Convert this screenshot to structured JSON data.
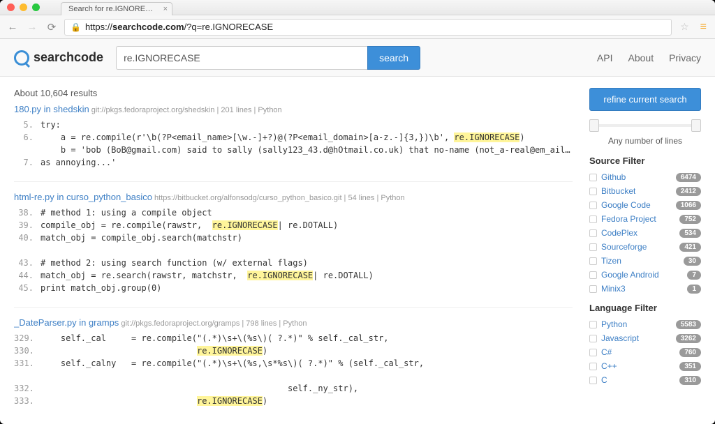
{
  "browser": {
    "tab_title": "Search for re.IGNORECASE",
    "url": "https://searchcode.com/?q=re.IGNORECASE",
    "host": "searchcode.com",
    "proto": "https://",
    "path": "/?q=re.IGNORECASE"
  },
  "brand": "searchcode",
  "search": {
    "value": "re.IGNORECASE",
    "button": "search"
  },
  "topnav": {
    "api": "API",
    "about": "About",
    "privacy": "Privacy"
  },
  "results_count": "About 10,604 results",
  "sidebar": {
    "refine": "refine current search",
    "slider_label": "Any number of lines",
    "source_head": "Source Filter",
    "sources": [
      {
        "label": "Github",
        "count": "6474"
      },
      {
        "label": "Bitbucket",
        "count": "2412"
      },
      {
        "label": "Google Code",
        "count": "1066"
      },
      {
        "label": "Fedora Project",
        "count": "752"
      },
      {
        "label": "CodePlex",
        "count": "534"
      },
      {
        "label": "Sourceforge",
        "count": "421"
      },
      {
        "label": "Tizen",
        "count": "30"
      },
      {
        "label": "Google Android",
        "count": "7"
      },
      {
        "label": "Minix3",
        "count": "1"
      }
    ],
    "lang_head": "Language Filter",
    "langs": [
      {
        "label": "Python",
        "count": "5583"
      },
      {
        "label": "Javascript",
        "count": "3262"
      },
      {
        "label": "C#",
        "count": "760"
      },
      {
        "label": "C++",
        "count": "351"
      },
      {
        "label": "C",
        "count": "310"
      }
    ]
  },
  "results": [
    {
      "title": "180.py in shedskin",
      "meta": "git://pkgs.fedoraproject.org/shedskin | 201 lines | Python",
      "lines": [
        {
          "n": "5",
          "t": "try:"
        },
        {
          "n": "6",
          "t": "    a = re.compile(r'\\b(?P<email_name>[\\w.-]+?)@(?P<email_domain>[a-z.-]{3,})\\b', ",
          "hl": "re.IGNORECASE",
          "after": ")"
        },
        {
          "n": "",
          "t": "    b = 'bob (BoB@gmail.com) said to sally (sally123_43.d@hOtmail.co.uk) that no-name (not_a-real@em_ail.dres) w"
        },
        {
          "n": "7",
          "t": "as annoying...'"
        }
      ]
    },
    {
      "title": "html-re.py in curso_python_basico",
      "meta": "https://bitbucket.org/alfonsodg/curso_python_basico.git | 54 lines | Python",
      "lines": [
        {
          "n": "38",
          "t": "# method 1: using a compile object"
        },
        {
          "n": "39",
          "t": "compile_obj = re.compile(rawstr,  ",
          "hl": "re.IGNORECASE",
          "after": "| re.DOTALL)"
        },
        {
          "n": "40",
          "t": "match_obj = compile_obj.search(matchstr)"
        },
        {
          "n": "",
          "t": " "
        },
        {
          "n": "43",
          "t": "# method 2: using search function (w/ external flags)"
        },
        {
          "n": "44",
          "t": "match_obj = re.search(rawstr, matchstr,  ",
          "hl": "re.IGNORECASE",
          "after": "| re.DOTALL)"
        },
        {
          "n": "45",
          "t": "print match_obj.group(0)"
        }
      ]
    },
    {
      "title": "_DateParser.py in gramps",
      "meta": "git://pkgs.fedoraproject.org/gramps | 798 lines | Python",
      "lines": [
        {
          "n": "329",
          "t": "    self._cal     = re.compile(\"(.*)\\s+\\(%s\\)( ?.*)\" % self._cal_str,"
        },
        {
          "n": "330",
          "t": "                               ",
          "hl": "re.IGNORECASE",
          "after": ")"
        },
        {
          "n": "331",
          "t": "    self._calny   = re.compile(\"(.*)\\s+\\(%s,\\s*%s\\)( ?.*)\" % (self._cal_str,"
        },
        {
          "n": "",
          "t": " "
        },
        {
          "n": "332",
          "t": "                                                 self._ny_str),"
        },
        {
          "n": "333",
          "t": "                               ",
          "hl": "re.IGNORECASE",
          "after": ")"
        }
      ]
    }
  ]
}
